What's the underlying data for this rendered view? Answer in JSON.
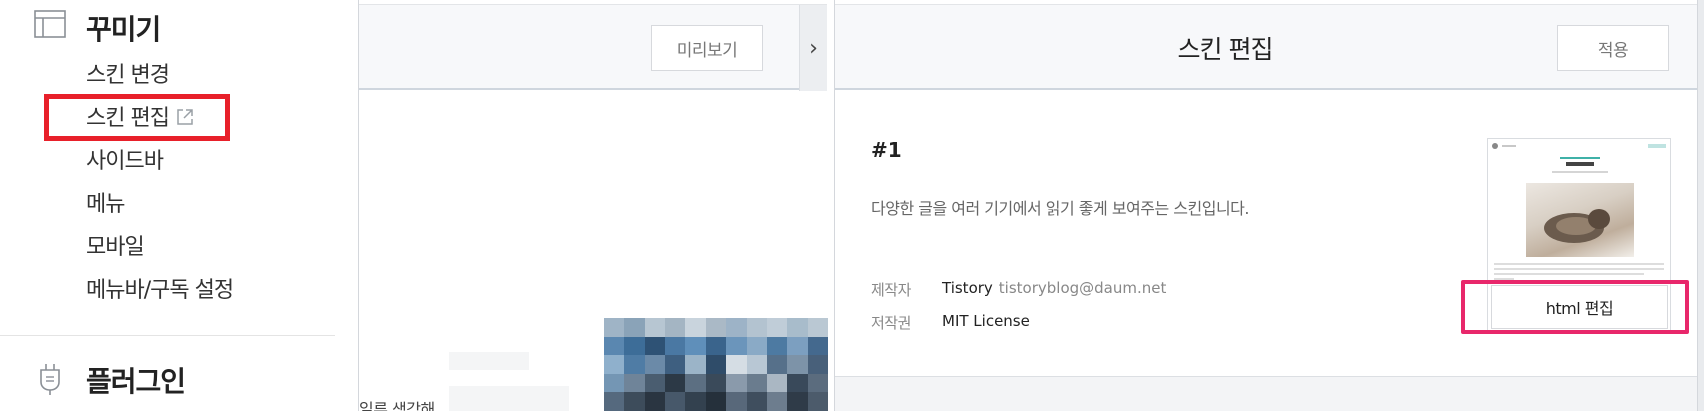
{
  "sidebar": {
    "decorate": {
      "title": "꾸미기",
      "icon": "layout-icon",
      "items": [
        {
          "label": "스킨 변경"
        },
        {
          "label": "스킨 편집",
          "icon": "external-link-icon",
          "highlighted": true
        },
        {
          "label": "사이드바"
        },
        {
          "label": "메뉴"
        },
        {
          "label": "모바일"
        },
        {
          "label": "메뉴바/구독 설정"
        }
      ]
    },
    "plugin": {
      "title": "플러그인",
      "icon": "plug-icon"
    }
  },
  "preview": {
    "button_label": "미리보기",
    "collapse_glyph": "›",
    "cut_text": "일류 생각해"
  },
  "editor": {
    "title": "스킨 편집",
    "apply_label": "적용",
    "skin": {
      "number": "#1",
      "description": "다양한 글을 여러 기기에서 읽기 좋게 보여주는 스킨입니다.",
      "author_label": "제작자",
      "author_name": "Tistory",
      "author_email": "tistoryblog@daum.net",
      "license_label": "저작권",
      "license_value": "MIT License",
      "edit_html_label": "html 편집"
    }
  },
  "colors": {
    "highlight_red": "#e8202a",
    "highlight_pink": "#e8276b",
    "header_bg": "#f7f8fa"
  }
}
